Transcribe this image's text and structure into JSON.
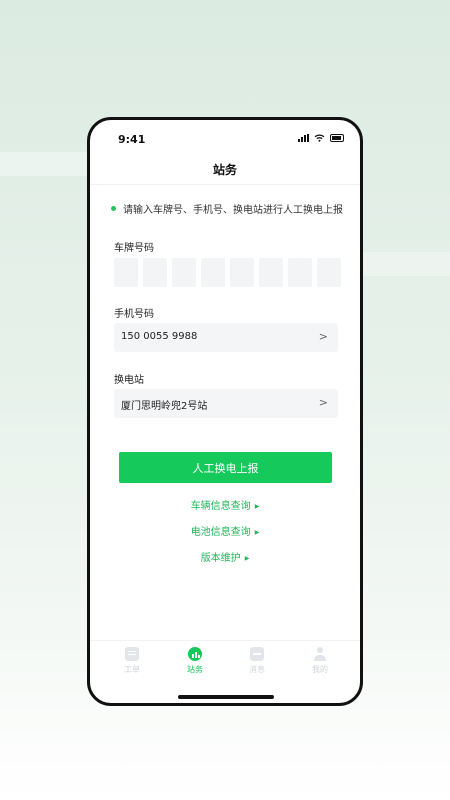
{
  "status_bar": {
    "time": "9:41"
  },
  "header": {
    "title": "站务"
  },
  "notice": "请输入车牌号、手机号、换电站进行人工换电上报",
  "form": {
    "plate_label": "车牌号码",
    "plate_slots": 8,
    "phone_label": "手机号码",
    "phone_value": "150 0055 9988",
    "station_label": "换电站",
    "station_value": "厦门思明岭兜2号站",
    "chevron": ">"
  },
  "actions": {
    "submit_label": "人工换电上报",
    "links": [
      "车辆信息查询",
      "电池信息查询",
      "版本维护"
    ],
    "link_marker": "▶"
  },
  "tabbar": {
    "items": [
      {
        "label": "工单",
        "icon": "work-order-icon",
        "active": false
      },
      {
        "label": "站务",
        "icon": "station-icon",
        "active": true
      },
      {
        "label": "消息",
        "icon": "message-icon",
        "active": false
      },
      {
        "label": "我的",
        "icon": "profile-icon",
        "active": false
      }
    ]
  },
  "colors": {
    "accent": "#16c95b",
    "link": "#1fb85a",
    "field_bg": "#f4f5f7"
  }
}
